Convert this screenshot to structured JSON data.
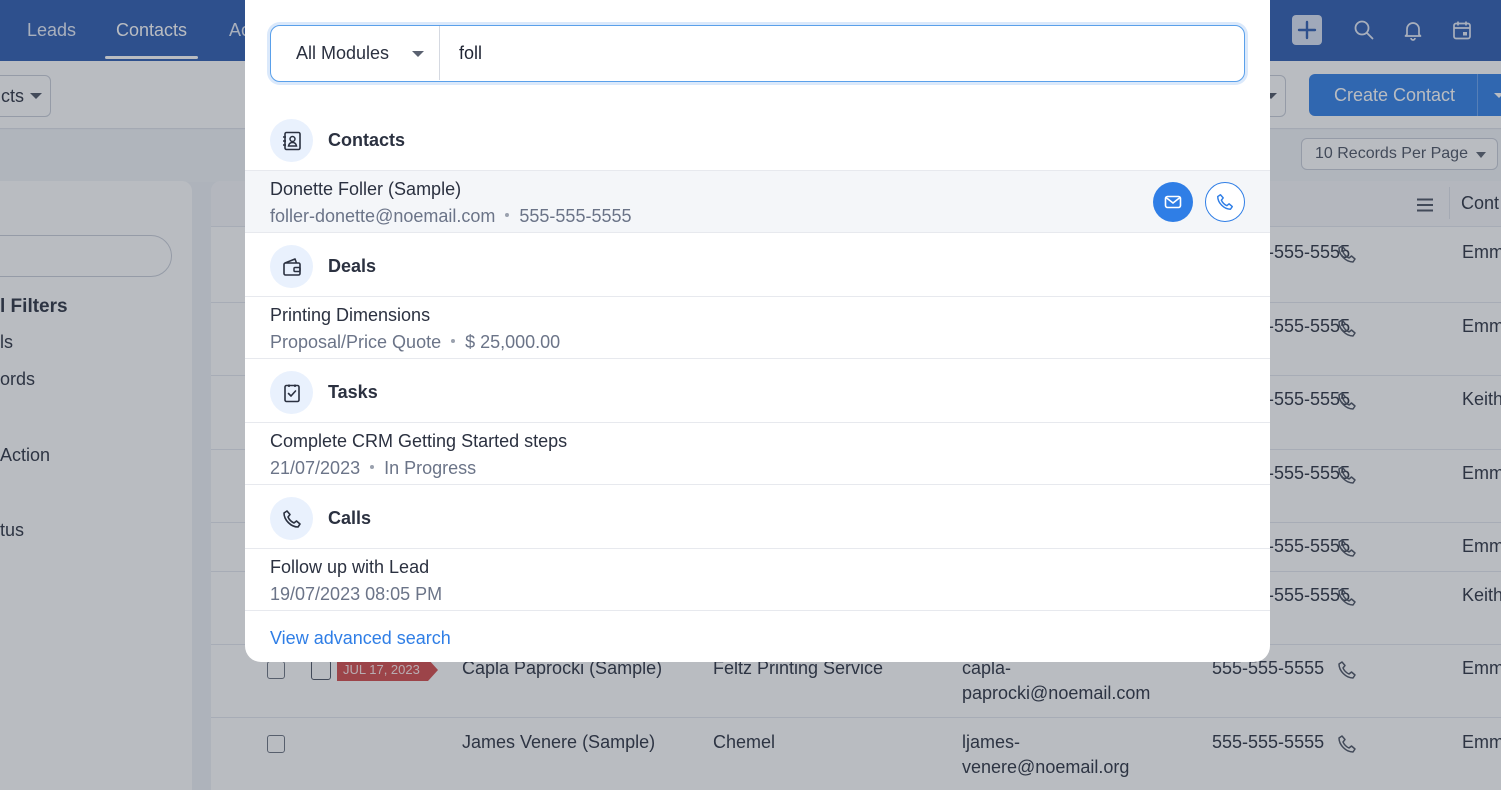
{
  "topnav": {
    "tabs": [
      {
        "label": "Leads"
      },
      {
        "label": "Contacts",
        "active": true
      },
      {
        "label": "Ac"
      }
    ],
    "icons": [
      "plus-icon",
      "search-icon",
      "bell-icon",
      "calendar-icon"
    ]
  },
  "toolbar": {
    "view_label": "cts",
    "create_label": "Create Contact"
  },
  "subbar": {
    "per_page": "10 Records Per Page"
  },
  "sidebar": {
    "items": [
      "l Filters",
      "ls",
      "ords",
      " Action",
      "tus"
    ]
  },
  "list": {
    "column_header": "Cont",
    "rows": [
      {
        "phone": "5-555-5555",
        "owner": "Emm"
      },
      {
        "phone": "5-555-5555",
        "owner": "Emm"
      },
      {
        "phone": "5-555-5555",
        "owner": "Keith"
      },
      {
        "phone": "5-555-5555",
        "owner": "Emm"
      },
      {
        "phone": "5-555-5555",
        "owner": "Emm"
      },
      {
        "phone": "5-555-5555",
        "owner": "Keith"
      },
      {
        "tag": "JUL 17, 2023",
        "name": "Capla Paprocki (Sample)",
        "account": "Feltz Printing Service",
        "email_1": "capla-",
        "email_2": "paprocki@noemail.com",
        "phone": "555-555-5555",
        "owner": "Emm"
      },
      {
        "name": "James Venere (Sample)",
        "account": "Chemel",
        "email_1": "ljames-",
        "email_2": "venere@noemail.org",
        "phone": "555-555-5555",
        "owner": "Emm"
      }
    ]
  },
  "search": {
    "module": "All Modules",
    "query": "foll",
    "sections": {
      "contacts": {
        "title": "Contacts",
        "result": {
          "title": "Donette Foller (Sample)",
          "email": "foller-donette@noemail.com",
          "phone": "555-555-5555"
        }
      },
      "deals": {
        "title": "Deals",
        "result": {
          "title": "Printing Dimensions",
          "stage": "Proposal/Price Quote",
          "amount": "$ 25,000.00"
        }
      },
      "tasks": {
        "title": "Tasks",
        "result": {
          "title": "Complete CRM Getting Started steps",
          "date": "21/07/2023",
          "status": "In Progress"
        }
      },
      "calls": {
        "title": "Calls",
        "result": {
          "title": "Follow up with Lead",
          "datetime": "19/07/2023 08:05 PM"
        }
      }
    },
    "advanced_link": "View advanced search"
  },
  "colors": {
    "nav": "#2c5bb0",
    "accent": "#2f7ee6",
    "tag": "#d44a4a"
  }
}
